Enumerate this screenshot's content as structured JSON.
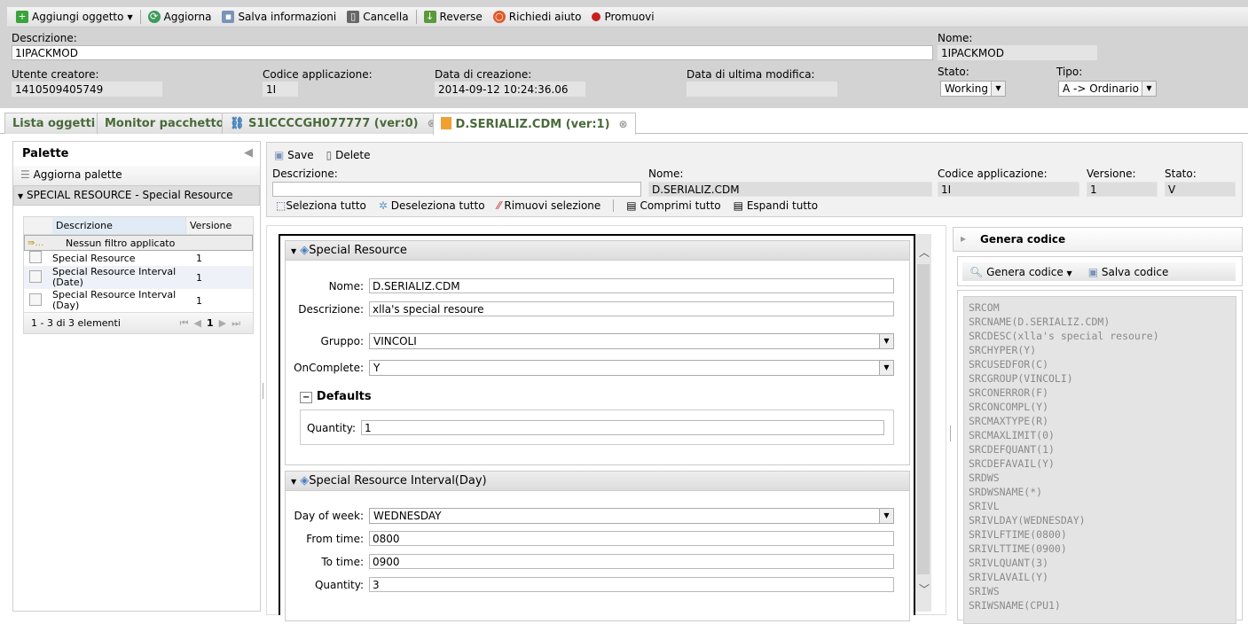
{
  "toolbar": {
    "items": [
      {
        "label": "Aggiungi oggetto",
        "icon": "plus-icon",
        "dropdown": true
      },
      {
        "label": "Aggiorna",
        "icon": "refresh-icon"
      },
      {
        "label": "Salva informazioni",
        "icon": "save-icon"
      },
      {
        "label": "Cancella",
        "icon": "trash-icon"
      },
      {
        "label": "Reverse",
        "icon": "reverse-icon"
      },
      {
        "label": "Richiedi aiuto",
        "icon": "lifebuoy-icon"
      },
      {
        "label": "Promuovi",
        "icon": "medal-icon"
      }
    ]
  },
  "header": {
    "descrizione_label": "Descrizione:",
    "descrizione": "1IPACKMOD",
    "nome_label": "Nome:",
    "nome": "1IPACKMOD",
    "utente_label": "Utente creatore:",
    "utente": "1410509405749",
    "codice_label": "Codice applicazione:",
    "codice": "1I",
    "data_creazione_label": "Data di creazione:",
    "data_creazione": "2014-09-12 10:24:36.06",
    "data_modifica_label": "Data di ultima modifica:",
    "data_modifica": "",
    "stato_label": "Stato:",
    "stato": "Working",
    "tipo_label": "Tipo:",
    "tipo": "A -> Ordinario"
  },
  "tabs": [
    {
      "label": "Lista oggetti"
    },
    {
      "label": "Monitor pacchetto"
    },
    {
      "label": "S1ICCCCGH077777 (ver:0)",
      "icon": "network-icon",
      "closable": true
    },
    {
      "label": "D.SERIALIZ.CDM (ver:1)",
      "icon": "document-icon",
      "closable": true,
      "active": true
    }
  ],
  "palette": {
    "title": "Palette",
    "refresh": "Aggiorna palette",
    "group": "SPECIAL RESOURCE - Special Resource",
    "columns": [
      "Descrizione",
      "Versione"
    ],
    "filter": "Nessun filtro applicato",
    "rows": [
      {
        "desc": "Special Resource",
        "ver": "1"
      },
      {
        "desc": "Special Resource Interval (Date)",
        "ver": "1"
      },
      {
        "desc": "Special Resource Interval (Day)",
        "ver": "1"
      }
    ],
    "pager": "1 - 3 di 3 elementi",
    "page": "1"
  },
  "object": {
    "save": "Save",
    "delete": "Delete",
    "descrizione_label": "Descrizione:",
    "descrizione": "",
    "nome_label": "Nome:",
    "nome": "D.SERIALIZ.CDM",
    "codice_label": "Codice applicazione:",
    "codice": "1I",
    "versione_label": "Versione:",
    "versione": "1",
    "stato_label": "Stato:",
    "stato": "V",
    "actions": [
      "Seleziona tutto",
      "Deseleziona tutto",
      "Rimuovi selezione",
      "Comprimi tutto",
      "Espandi tutto"
    ]
  },
  "form": {
    "section1": {
      "title": "Special Resource",
      "nome_label": "Nome:",
      "nome": "D.SERIALIZ.CDM",
      "desc_label": "Descrizione:",
      "desc": "xlla's special resoure",
      "gruppo_label": "Gruppo:",
      "gruppo": "VINCOLI",
      "oncomplete_label": "OnComplete:",
      "oncomplete": "Y",
      "defaults_title": "Defaults",
      "quantity_label": "Quantity:",
      "quantity": "1"
    },
    "section2": {
      "title": "Special Resource Interval(Day)",
      "dow_label": "Day of week:",
      "dow": "WEDNESDAY",
      "from_label": "From time:",
      "from": "0800",
      "to_label": "To time:",
      "to": "0900",
      "quantity_label": "Quantity:",
      "quantity": "3"
    }
  },
  "code": {
    "title": "Genera codice",
    "generate": "Genera codice",
    "save": "Salva codice",
    "lines": [
      "SRCOM",
      "SRCNAME(D.SERIALIZ.CDM)",
      "SRCDESC(xlla's special resoure)",
      "SRCHYPER(Y)",
      "SRCUSEDFOR(C)",
      "SRCGROUP(VINCOLI)",
      "SRCONERROR(F)",
      "SRCONCOMPL(Y)",
      "SRCMAXTYPE(R)",
      "SRCMAXLIMIT(0)",
      "SRCDEFQUANT(1)",
      "SRCDEFAVAIL(Y)",
      "SRDWS",
      "SRDWSNAME(*)",
      "SRIVL",
      "SRIVLDAY(WEDNESDAY)",
      "SRIVLFTIME(0800)",
      "SRIVLTTIME(0900)",
      "SRIVLQUANT(3)",
      "SRIVLAVAIL(Y)",
      "SRIWS",
      "SRIWSNAME(CPU1)"
    ]
  }
}
